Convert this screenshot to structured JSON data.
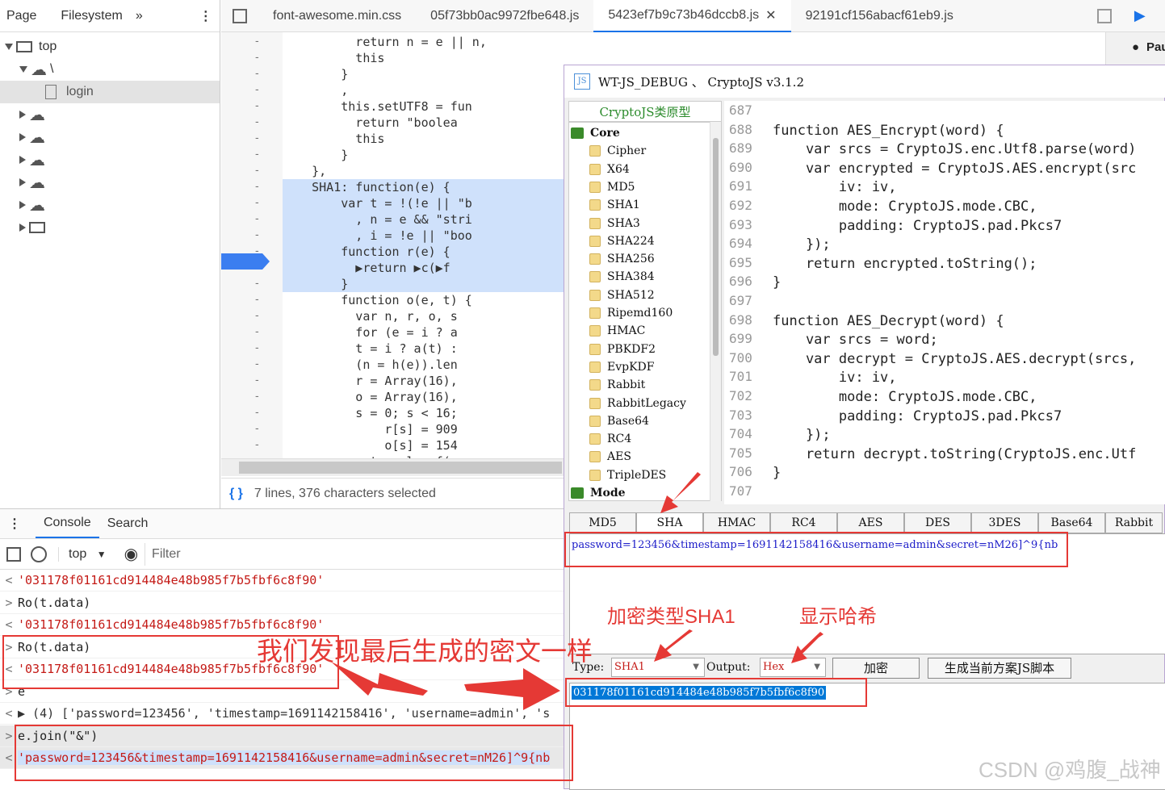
{
  "left_panel": {
    "tabs": [
      "Page",
      "Filesystem",
      "»"
    ],
    "top_label": "top",
    "login_label": "login",
    "backslash": "\\"
  },
  "file_tabs": [
    "font-awesome.min.css",
    "05f73bb0ac9972fbe648.js",
    "5423ef7b9c73b46dccb8.js",
    "92191cf156abacf61eb9.js"
  ],
  "active_tab_index": 2,
  "paused_label": "Pau",
  "editor_lines": [
    "          return n = e || n,",
    "          this",
    "        }",
    "        ,",
    "        this.setUTF8 = fun",
    "          return \"boolea",
    "          this",
    "        }",
    "    },",
    "    SHA1: function(e) {",
    "        var t = !(!e || \"b",
    "          , n = e && \"stri",
    "          , i = !e || \"boo",
    "        function r(e) {",
    "          ▶return ▶c(▶f",
    "        }",
    "        function o(e, t) {",
    "          var n, r, o, s",
    "          for (e = i ? a",
    "          t = i ? a(t) :",
    "          (n = h(e)).len",
    "          r = Array(16),",
    "          o = Array(16),",
    "          s = 0; s < 16;",
    "              r[s] = 909",
    "              o[s] = 154",
    "          return l = f(r"
  ],
  "status": {
    "selection_text": "7 lines, 376 characters selected"
  },
  "drawer": {
    "tabs": [
      "Console",
      "Search"
    ],
    "context": "top",
    "filter_placeholder": "Filter"
  },
  "console_rows": [
    {
      "prefix": "<",
      "text": "'031178f01161cd914484e48b985f7b5fbf6c8f90'",
      "kind": "str"
    },
    {
      "prefix": ">",
      "text": "Ro(t.data)",
      "kind": "in"
    },
    {
      "prefix": "<",
      "text": "'031178f01161cd914484e48b985f7b5fbf6c8f90'",
      "kind": "str"
    },
    {
      "prefix": ">",
      "text": "Ro(t.data)",
      "kind": "in"
    },
    {
      "prefix": "<",
      "text": "'031178f01161cd914484e48b985f7b5fbf6c8f90'",
      "kind": "str"
    },
    {
      "prefix": ">",
      "text": "e",
      "kind": "in"
    },
    {
      "prefix": "<",
      "text": "▶ (4) ['password=123456', 'timestamp=1691142158416', 'username=admin', 's",
      "kind": "obj"
    },
    {
      "prefix": ">",
      "text": "e.join(\"&\")",
      "kind": "in"
    },
    {
      "prefix": "<",
      "text": "'password=123456&timestamp=1691142158416&username=admin&secret=nM26]^9{nb",
      "kind": "str"
    }
  ],
  "tool": {
    "title": "WT-JS_DEBUG 、 CryptoJS v3.1.2",
    "tree_header": "CryptoJS类原型",
    "tree_items": [
      "Core",
      "Cipher",
      "X64",
      "MD5",
      "SHA1",
      "SHA3",
      "SHA224",
      "SHA256",
      "SHA384",
      "SHA512",
      "Ripemd160",
      "HMAC",
      "PBKDF2",
      "EvpKDF",
      "Rabbit",
      "RabbitLegacy",
      "Base64",
      "RC4",
      "AES",
      "TripleDES",
      "Mode"
    ],
    "line_numbers": [
      "687",
      "688",
      "689",
      "690",
      "691",
      "692",
      "693",
      "694",
      "695",
      "696",
      "697",
      "698",
      "699",
      "700",
      "701",
      "702",
      "703",
      "704",
      "705",
      "706",
      "707"
    ],
    "code_lines": [
      "",
      "function AES_Encrypt(word) {",
      "    var srcs = CryptoJS.enc.Utf8.parse(word)",
      "    var encrypted = CryptoJS.AES.encrypt(src",
      "        iv: iv,",
      "        mode: CryptoJS.mode.CBC,",
      "        padding: CryptoJS.pad.Pkcs7",
      "    });",
      "    return encrypted.toString();",
      "}",
      "",
      "function AES_Decrypt(word) {",
      "    var srcs = word;",
      "    var decrypt = CryptoJS.AES.decrypt(srcs,",
      "        iv: iv,",
      "        mode: CryptoJS.mode.CBC,",
      "        padding: CryptoJS.pad.Pkcs7",
      "    });",
      "    return decrypt.toString(CryptoJS.enc.Utf",
      "}",
      ""
    ],
    "alg_tabs": [
      "MD5",
      "SHA",
      "HMAC",
      "RC4",
      "AES",
      "DES",
      "3DES",
      "Base64",
      "Rabbit"
    ],
    "selected_alg_tab": 1,
    "input_text": "password=123456&timestamp=1691142158416&username=admin&secret=nM26]^9{nb",
    "type_label": "Type:",
    "type_value": "SHA1",
    "output_label": "Output:",
    "output_value": "Hex",
    "encrypt_button": "加密",
    "gen_script_button": "生成当前方案JS脚本",
    "output_text": "031178f01161cd914484e48b985f7b5fbf6c8f90"
  },
  "annotations": {
    "type_note": "加密类型SHA1",
    "hash_note": "显示哈希",
    "same_note": "我们发现最后生成的密文一样"
  },
  "watermark": "CSDN @鸡腹_战神",
  "colors": {
    "annotation_red": "#e53935",
    "selection_blue": "#cfe1fb",
    "tool_output_blue": "#0078d7"
  }
}
